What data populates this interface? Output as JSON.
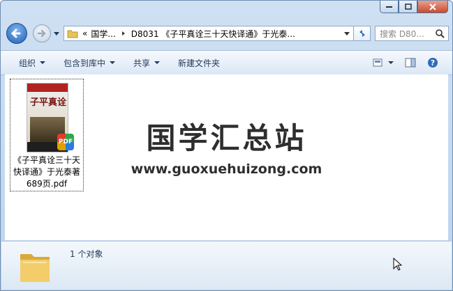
{
  "addressbar": {
    "overflow": "«",
    "crumb1": "国学...",
    "crumb2": "D8031 《子平真诠三十天快译通》于光泰..."
  },
  "search": {
    "placeholder": "搜索 D80..."
  },
  "toolbar": {
    "organize": "组织",
    "include_library": "包含到库中",
    "share": "共享",
    "new_folder": "新建文件夹"
  },
  "file": {
    "name_line1": "《子平真诠三十天",
    "name_line2": "快译通》于光泰著",
    "name_line3": "689页.pdf",
    "thumb_title": "子平真诠",
    "badge": "PDF"
  },
  "watermark": {
    "cn": "国学汇总站",
    "url": "www.guoxuehuizong.com"
  },
  "details": {
    "count": "1 个对象"
  },
  "colors": {
    "titlebar": "#bcd3ec",
    "close": "#c94b2c",
    "accent": "#1e5fb6"
  }
}
